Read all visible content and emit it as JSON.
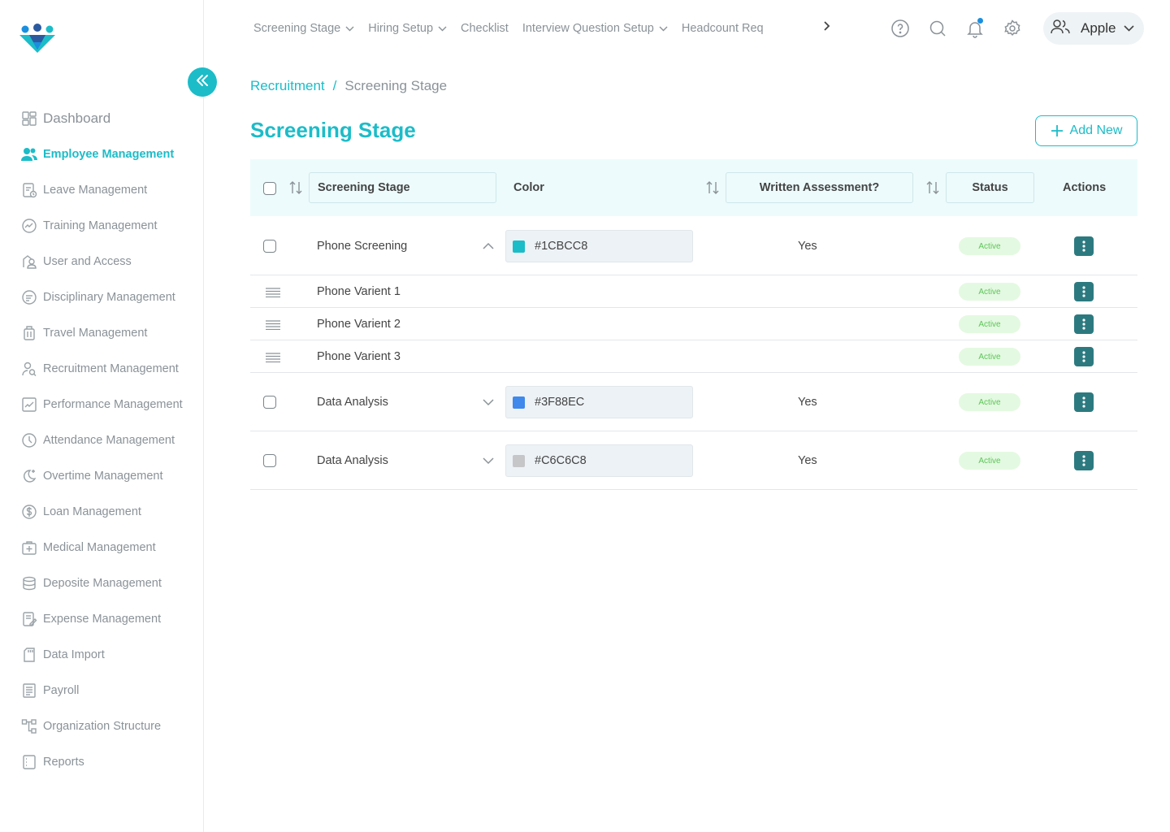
{
  "brand": {
    "accent": "#1CBCC8",
    "logo": "company-logo"
  },
  "sidebar": {
    "items": [
      {
        "label": "Dashboard",
        "icon": "dashboard-icon"
      },
      {
        "label": "Employee Management",
        "icon": "users-icon",
        "active": true
      },
      {
        "label": "Leave Management",
        "icon": "leave-icon"
      },
      {
        "label": "Training Management",
        "icon": "training-icon"
      },
      {
        "label": "User and Access",
        "icon": "user-access-icon"
      },
      {
        "label": "Disciplinary Management",
        "icon": "disciplinary-icon"
      },
      {
        "label": "Travel Management",
        "icon": "luggage-icon"
      },
      {
        "label": "Recruitment Management",
        "icon": "recruitment-icon"
      },
      {
        "label": "Performance Management",
        "icon": "performance-icon"
      },
      {
        "label": "Attendance Management",
        "icon": "clock-icon"
      },
      {
        "label": "Overtime Management",
        "icon": "moon-icon"
      },
      {
        "label": "Loan Management",
        "icon": "dollar-icon"
      },
      {
        "label": "Medical Management",
        "icon": "medical-icon"
      },
      {
        "label": "Deposite Management",
        "icon": "database-icon"
      },
      {
        "label": "Expense Management",
        "icon": "expense-icon"
      },
      {
        "label": "Data Import",
        "icon": "sd-card-icon"
      },
      {
        "label": "Payroll",
        "icon": "payroll-icon"
      },
      {
        "label": "Organization Structure",
        "icon": "org-structure-icon"
      },
      {
        "label": "Reports",
        "icon": "reports-icon"
      }
    ]
  },
  "topnav": {
    "items": [
      {
        "label": "Screening Stage",
        "dropdown": true
      },
      {
        "label": "Hiring Setup",
        "dropdown": true
      },
      {
        "label": "Checklist",
        "dropdown": false
      },
      {
        "label": "Interview Question Setup",
        "dropdown": true
      },
      {
        "label": "Headcount Req",
        "dropdown": false
      }
    ]
  },
  "user": {
    "name": "Apple"
  },
  "breadcrumb": {
    "parent": "Recruitment",
    "separator": "/",
    "current": "Screening Stage"
  },
  "page": {
    "title": "Screening Stage",
    "add_label": "Add New"
  },
  "table": {
    "headers": {
      "stage": "Screening Stage",
      "color": "Color",
      "written": "Written Assessment?",
      "status": "Status",
      "actions": "Actions"
    },
    "rows": [
      {
        "name": "Phone Screening",
        "color": "#1CBCC8",
        "written": "Yes",
        "status": "Active",
        "expanded": true,
        "children": [
          {
            "name": "Phone Varient 1",
            "status": "Active"
          },
          {
            "name": "Phone Varient 2",
            "status": "Active"
          },
          {
            "name": "Phone Varient 3",
            "status": "Active"
          }
        ]
      },
      {
        "name": "Data Analysis",
        "color": "#3F88EC",
        "written": "Yes",
        "status": "Active",
        "expanded": false
      },
      {
        "name": "Data Analysis",
        "color": "#C6C6C8",
        "written": "Yes",
        "status": "Active",
        "expanded": false
      }
    ]
  }
}
